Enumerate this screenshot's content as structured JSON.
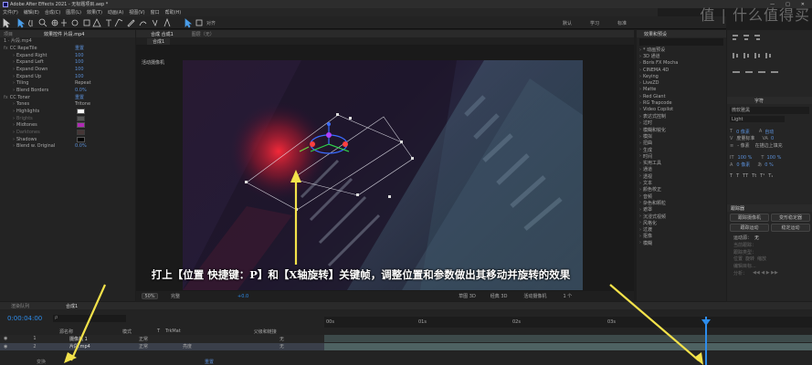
{
  "app": {
    "title": "Adobe After Effects 2021 - 无标题项目.aep *"
  },
  "window_controls": [
    "—",
    "□",
    "✕"
  ],
  "menu": [
    "文件(F)",
    "编辑(E)",
    "合成(C)",
    "图层(L)",
    "效果(T)",
    "动画(A)",
    "视图(V)",
    "窗口",
    "帮助(H)"
  ],
  "toolbar": {
    "snap_label": "对齐"
  },
  "workspaces": [
    "默认",
    "学习",
    "标准"
  ],
  "watermark": "值 | 什么值得买",
  "left_panel": {
    "tab_project": "项目",
    "tab_effects": "效果控件 片段.mp4",
    "layer_name": "1 · 片段.mp4",
    "effects": [
      {
        "indent": 0,
        "label": "CC RepeTile",
        "value": "重置",
        "type": "group"
      },
      {
        "indent": 1,
        "label": "Expand Right",
        "value": "100",
        "type": "num"
      },
      {
        "indent": 1,
        "label": "Expand Left",
        "value": "100",
        "type": "num"
      },
      {
        "indent": 1,
        "label": "Expand Down",
        "value": "100",
        "type": "num"
      },
      {
        "indent": 1,
        "label": "Expand Up",
        "value": "100",
        "type": "num"
      },
      {
        "indent": 1,
        "label": "Tiling",
        "value": "Repeat",
        "type": "select"
      },
      {
        "indent": 1,
        "label": "Blend Borders",
        "value": "0.0%",
        "type": "num"
      },
      {
        "indent": 0,
        "label": "CC Toner",
        "value": "重置",
        "type": "group"
      },
      {
        "indent": 1,
        "label": "Tones",
        "value": "Tritone",
        "type": "select"
      },
      {
        "indent": 1,
        "label": "Highlights",
        "value": "",
        "type": "color",
        "color": "#ffffff"
      },
      {
        "indent": 1,
        "label": "Brights",
        "value": "",
        "type": "color-dim",
        "color": "#8a8a8a"
      },
      {
        "indent": 1,
        "label": "Midtones",
        "value": "",
        "type": "color",
        "color": "#b02ab5"
      },
      {
        "indent": 1,
        "label": "Darktones",
        "value": "",
        "type": "color-dim",
        "color": "#6a4a4a"
      },
      {
        "indent": 1,
        "label": "Shadows",
        "value": "",
        "type": "color",
        "color": "#000000"
      },
      {
        "indent": 1,
        "label": "Blend w. Original",
        "value": "0.0%",
        "type": "num"
      }
    ]
  },
  "comp_panel": {
    "tab_comp": "合成 合成1",
    "tab_layer": "图层（无）",
    "subtab": "合成1",
    "camera_label": "活动摄像机",
    "annotation": "打上【位置 快捷键：P】和【X轴旋转】关键帧，调整位置和参数做出其移动并旋转的效果",
    "zoom": "50%",
    "resolution": "完整",
    "exposure": "+0.0",
    "renderer": "草图 3D",
    "view_mode": "经典 3D",
    "camera_select": "活动摄像机",
    "views": "1 个"
  },
  "right_panel": {
    "effects_title": "效果和预设",
    "effect_items": [
      "* 动画预设",
      "3D 通道",
      "Boris FX Mocha",
      "CINEMA 4D",
      "Keying",
      "LiveZD",
      "Matte",
      "Red Giant",
      "RG Trapcode",
      "Video Copilot",
      "表达式控制",
      "过时",
      "模糊和锐化",
      "模拟",
      "扭曲",
      "生成",
      "时间",
      "实用工具",
      "通道",
      "透视",
      "文本",
      "颜色校正",
      "音频",
      "杂色和颗粒",
      "遮罩",
      "沉浸式视频",
      "风格化",
      "过渡",
      "抠像",
      "模糊"
    ],
    "char_title": "字符",
    "font_name": "微软雅黑",
    "font_style": "Light",
    "font_size": "0 像素",
    "leading": "自动",
    "kerning": "度量标准",
    "tracking": "0",
    "stroke": "- 像素",
    "stroke_mode": "在描边上填充",
    "vscale": "100 %",
    "hscale": "100 %",
    "baseline": "0 像素",
    "tsume": "0 %",
    "tracker_title": "跟踪器",
    "tracker_buttons": [
      "跟踪摄像机",
      "变形稳定器",
      "跟踪运动",
      "稳定运动"
    ],
    "motion_source_label": "运动源：",
    "motion_source": "无",
    "current_track_label": "当前跟踪：",
    "track_type_label": "跟踪类型：",
    "options": [
      "位置",
      "旋转",
      "缩放"
    ],
    "edit_target": "编辑目标...",
    "analyze_label": "分析："
  },
  "timeline": {
    "tab_render": "渲染队列",
    "tab_comp": "合成1",
    "timecode": "0:00:04:00",
    "search_placeholder": "ρ",
    "col_src": "源名称",
    "col_mode": "模式",
    "col_t": "T",
    "col_trkmat": "TrkMat",
    "col_parent": "父级和链接",
    "rulers": [
      "00s",
      "01s",
      "02s",
      "03s"
    ],
    "layers": [
      {
        "num": "1",
        "name": "摄像机 1",
        "mode": "正常",
        "trk": "",
        "parent": "无"
      },
      {
        "num": "2",
        "name": "片段.mp4",
        "mode": "正常",
        "trk": "亮度",
        "parent": "无"
      }
    ],
    "sub_row": "变换",
    "sub_reset": "重置"
  },
  "colors": {
    "accent": "#2d8ceb",
    "annotation_text": "#ffffff",
    "arrow": "#f3e24a"
  }
}
